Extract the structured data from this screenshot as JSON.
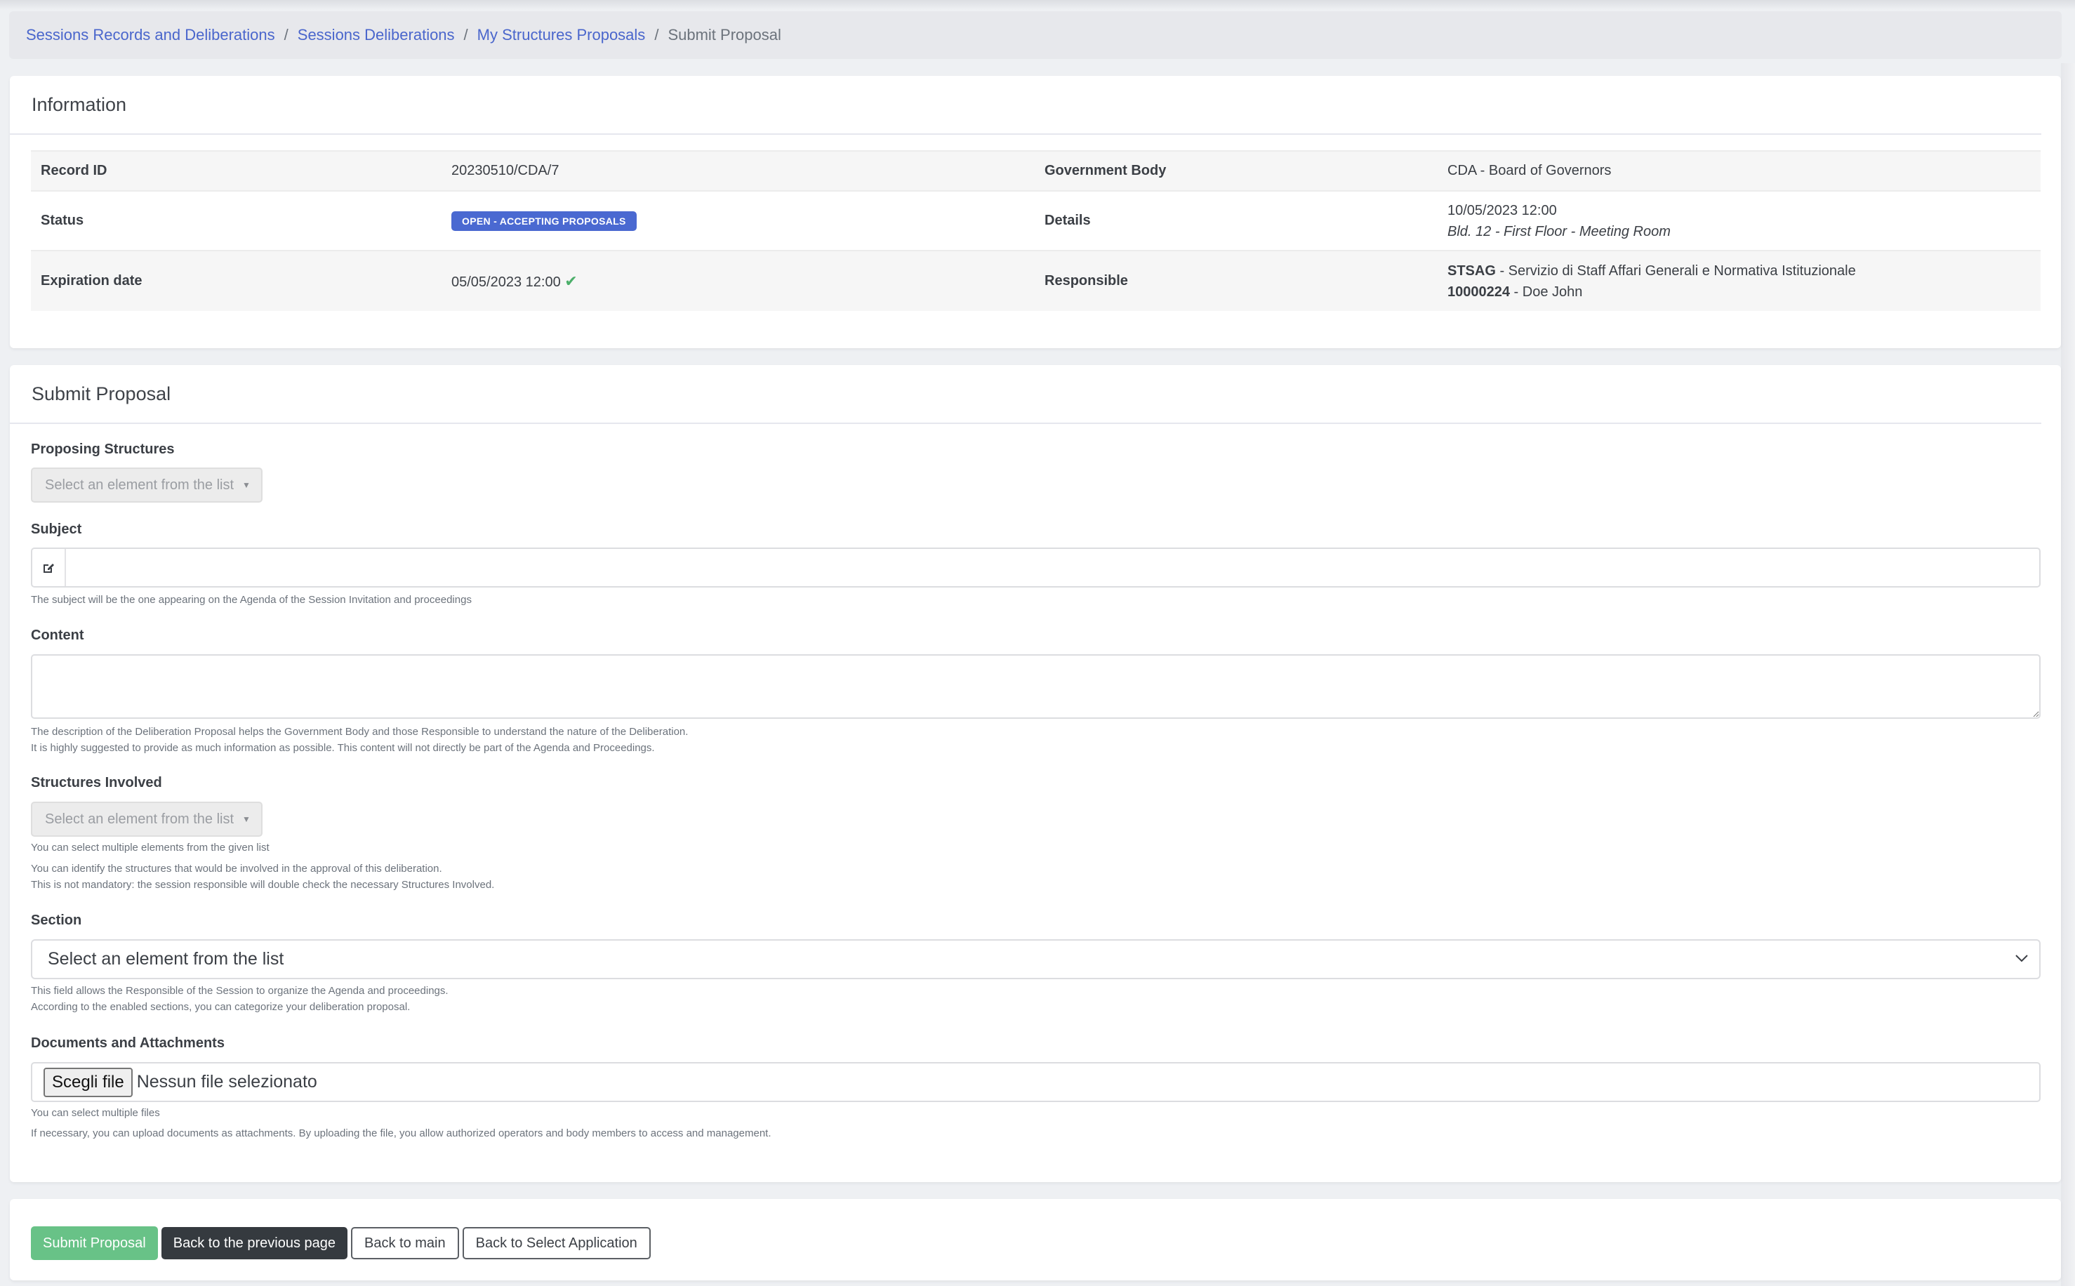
{
  "breadcrumb": {
    "items": [
      {
        "label": "Sessions Records and Deliberations"
      },
      {
        "label": "Sessions Deliberations"
      },
      {
        "label": "My Structures Proposals"
      }
    ],
    "current": "Submit Proposal",
    "separator": "/"
  },
  "information": {
    "title": "Information",
    "record_id_label": "Record ID",
    "record_id": "20230510/CDA/7",
    "government_body_label": "Government Body",
    "government_body": "CDA - Board of Governors",
    "status_label": "Status",
    "status_badge": "OPEN - ACCEPTING PROPOSALS",
    "details_label": "Details",
    "details_datetime": "10/05/2023 12:00",
    "details_location": "Bld. 12 - First Floor - Meeting Room",
    "expiration_label": "Expiration date",
    "expiration_date": "05/05/2023 12:00",
    "expiration_icon": "check-icon",
    "responsible_label": "Responsible",
    "responsible_structure_code": "STSAG",
    "responsible_structure_name": " - Servizio di Staff Affari Generali e Normativa Istituzionale",
    "responsible_person_id": "10000224",
    "responsible_person_name": " - Doe John"
  },
  "form": {
    "title": "Submit Proposal",
    "proposing_structures": {
      "label": "Proposing Structures",
      "placeholder": "Select an element from the list"
    },
    "subject": {
      "label": "Subject",
      "icon": "edit-icon",
      "value": "",
      "help": "The subject will be the one appearing on the Agenda of the Session Invitation and proceedings"
    },
    "content": {
      "label": "Content",
      "value": "",
      "help_1": "The description of the Deliberation Proposal helps the Government Body and those Responsible to understand the nature of the Deliberation.",
      "help_2": "It is highly suggested to provide as much information as possible. This content will not directly be part of the Agenda and Proceedings."
    },
    "structures_involved": {
      "label": "Structures Involved",
      "placeholder": "Select an element from the list",
      "help_1": "You can select multiple elements from the given list",
      "help_2": "You can identify the structures that would be involved in the approval of this deliberation.",
      "help_3": "This is not mandatory: the session responsible will double check the necessary Structures Involved."
    },
    "section": {
      "label": "Section",
      "selected": "Select an element from the list",
      "help_1": "This field allows the Responsible of the Session to organize the Agenda and proceedings.",
      "help_2": "According to the enabled sections, you can categorize your deliberation proposal."
    },
    "documents": {
      "label": "Documents and Attachments",
      "button": "Scegli file",
      "no_file": "Nessun file selezionato",
      "help_1": "You can select multiple files",
      "help_2": "If necessary, you can upload documents as attachments. By uploading the file, you allow authorized operators and body members to access and management."
    }
  },
  "actions": {
    "submit": "Submit Proposal",
    "back_previous": "Back to the previous page",
    "back_main": "Back to main",
    "back_select_app": "Back to Select Application"
  },
  "colors": {
    "link": "#4a66cc",
    "badge": "#4a69d1",
    "success": "#68c287",
    "dark": "#353a3f"
  }
}
